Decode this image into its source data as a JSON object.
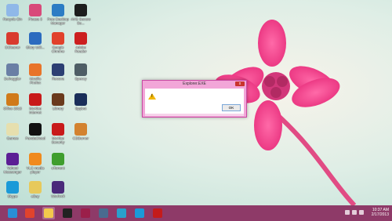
{
  "desktop": {
    "icons": [
      {
        "label": "Recycle Bin",
        "color": "#8fb8e8"
      },
      {
        "label": "Picasa 3",
        "color": "#d84a7a"
      },
      {
        "label": "Free Desktop Manager",
        "color": "#2c7cc4"
      },
      {
        "label": "AVG Secure Se...",
        "color": "#1d1d1d"
      },
      {
        "label": "CCleaner",
        "color": "#d93a2e"
      },
      {
        "label": "Glary Utili...",
        "color": "#2b6bbf"
      },
      {
        "label": "Google Chrome",
        "color": "#e1412b"
      },
      {
        "label": "Adobe Reader",
        "color": "#cc1f1f"
      },
      {
        "label": "Defraggler",
        "color": "#6a7fa5"
      },
      {
        "label": "Mozilla Firefox",
        "color": "#e8742a"
      },
      {
        "label": "Recuva",
        "color": "#2c3f73"
      },
      {
        "label": "Speccy",
        "color": "#4f5e66"
      },
      {
        "label": "Office 2013",
        "color": "#d07a1a"
      },
      {
        "label": "McAfee Internet",
        "color": "#c81a1a"
      },
      {
        "label": "Library",
        "color": "#6a3a1d"
      },
      {
        "label": "Spybot",
        "color": "#1a2e5a"
      },
      {
        "label": "Games",
        "color": "#e6dfae"
      },
      {
        "label": "PandaCloud",
        "color": "#111"
      },
      {
        "label": "McAfee Security",
        "color": "#c81a1a"
      },
      {
        "label": "CDBurner",
        "color": "#d3822f"
      },
      {
        "label": "Yahoo! Messenger",
        "color": "#5c1f95"
      },
      {
        "label": "VLC media player",
        "color": "#f08a1d"
      },
      {
        "label": "uTorrent",
        "color": "#3f9e2e"
      },
      {
        "label": "Skype",
        "color": "#1a9ad8"
      },
      {
        "label": "eBay",
        "color": "#e7c95b"
      },
      {
        "label": "WinRAR",
        "color": "#4a2a7a"
      }
    ]
  },
  "dialog": {
    "title": "Explorer.EXE",
    "close_label": "x",
    "warning_glyph": "!",
    "ok_label": "OK"
  },
  "taskbar": {
    "buttons": [
      {
        "name": "ie",
        "color": "#2a8fd6",
        "active": false
      },
      {
        "name": "chrome",
        "color": "#e0432d",
        "active": false
      },
      {
        "name": "explorer",
        "color": "#f2c94c",
        "active": true
      },
      {
        "name": "amazon",
        "color": "#222222",
        "active": false
      },
      {
        "name": "app1",
        "color": "#9b1f4a",
        "active": false
      },
      {
        "name": "app2",
        "color": "#4a6b8f",
        "active": false
      },
      {
        "name": "app3",
        "color": "#2aa0cc",
        "active": false
      },
      {
        "name": "skype",
        "color": "#1a9ad8",
        "active": false
      },
      {
        "name": "app4",
        "color": "#c41b1b",
        "active": false
      }
    ],
    "time": "10:37 AM",
    "date": "2/17/2013"
  }
}
